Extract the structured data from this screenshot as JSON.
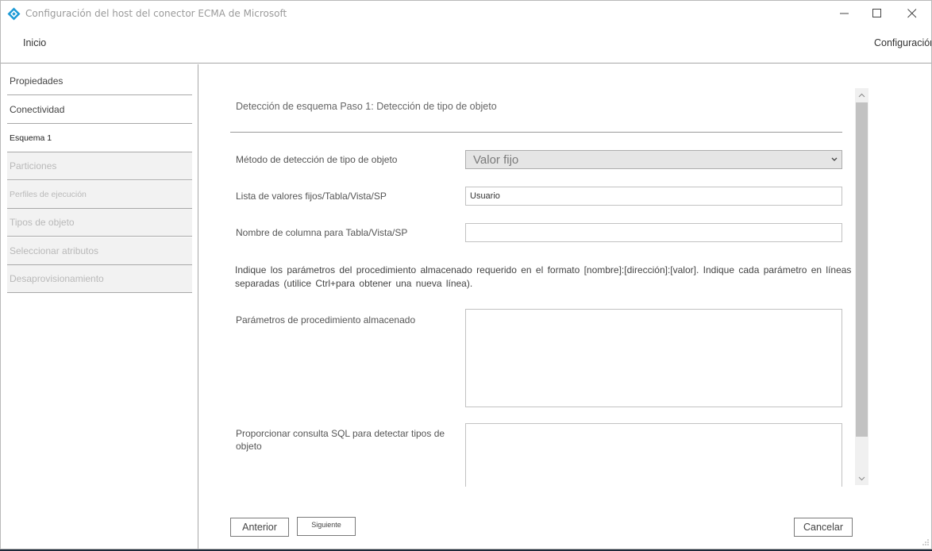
{
  "window": {
    "title": "Configuración del host del conector ECMA de Microsoft",
    "accent_color": "#1c9ad6"
  },
  "menu": {
    "home": "Inicio",
    "settings": "Configuración"
  },
  "sidebar": {
    "items": [
      {
        "label": "Propiedades",
        "state": "enabled"
      },
      {
        "label": "Conectividad",
        "state": "enabled"
      },
      {
        "label": "Esquema 1",
        "state": "current"
      },
      {
        "label": "Particiones",
        "state": "disabled"
      },
      {
        "label": "Perfiles de ejecución",
        "state": "disabled"
      },
      {
        "label": "Tipos de objeto",
        "state": "disabled"
      },
      {
        "label": "Seleccionar atributos",
        "state": "disabled"
      },
      {
        "label": "Desaprovisionamiento",
        "state": "disabled"
      }
    ]
  },
  "main": {
    "step_title": "Detección de esquema Paso 1: Detección de tipo de objeto",
    "detection_method": {
      "label": "Método de detección de tipo de objeto",
      "value": "Valor fijo"
    },
    "fixed_values": {
      "label": "Lista de valores fijos/Tabla/Vista/SP",
      "value": "Usuario"
    },
    "column_name": {
      "label": "Nombre de columna para Tabla/Vista/SP",
      "value": ""
    },
    "instructions_line1": "Indique los parámetros del procedimiento almacenado requerido en el formato [nombre]:[dirección]:[valor]. Indique cada parámetro en líneas",
    "instructions_line2": "separadas (utilice Ctrl+para obtener una nueva línea).",
    "stored_procedure_params": {
      "label": "Parámetros de procedimiento almacenado",
      "value": ""
    },
    "sql_query": {
      "label": "Proporcionar consulta SQL para detectar tipos de objeto",
      "value": ""
    }
  },
  "footer": {
    "previous": "Anterior",
    "next": "Siguiente",
    "cancel": "Cancelar"
  },
  "icons": {
    "app": "connector-diamond-icon",
    "minimize": "minimize-icon",
    "maximize": "maximize-icon",
    "close": "close-icon",
    "dropdown": "chevron-down-icon",
    "scroll_up": "chevron-up-icon",
    "scroll_down": "chevron-down-icon",
    "resize": "resize-grip-icon"
  }
}
